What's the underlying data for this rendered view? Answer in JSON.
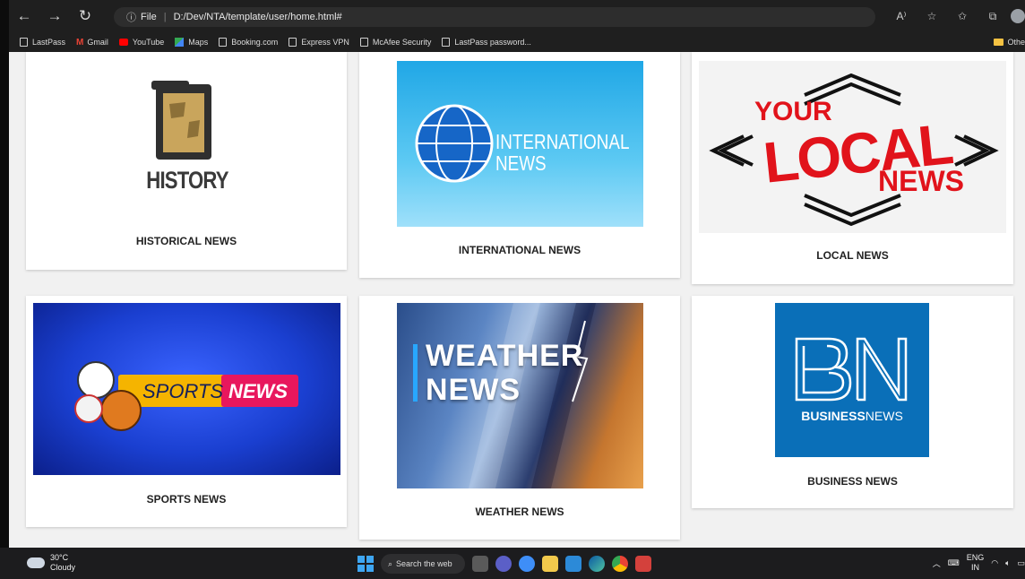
{
  "browser": {
    "address": "D:/Dev/NTA/template/user/home.html#",
    "file_label": "File",
    "bookmarks": [
      "LastPass",
      "Gmail",
      "YouTube",
      "Maps",
      "Booking.com",
      "Express VPN",
      "McAfee Security",
      "LastPass password..."
    ],
    "other_bookmarks": "Othe"
  },
  "cards": [
    {
      "caption": "HISTORICAL NEWS",
      "logo": "HISTORY NEWS"
    },
    {
      "caption": "INTERNATIONAL NEWS",
      "logo_line1": "INTERNATIONAL",
      "logo_line2": "NEWS"
    },
    {
      "caption": "LOCAL NEWS",
      "logo_line1": "YOUR",
      "logo_line2": "LOCAL",
      "logo_line3": "NEWS"
    },
    {
      "caption": "SPORTS NEWS",
      "logo_line1": "SPORTS",
      "logo_line2": "NEWS"
    },
    {
      "caption": "WEATHER NEWS",
      "logo_line1": "WEATHER",
      "logo_line2": "NEWS"
    },
    {
      "caption": "BUSINESS NEWS",
      "logo_mark": "BN",
      "logo_bold": "BUSINESS",
      "logo_light": "NEWS"
    }
  ],
  "taskbar": {
    "temperature": "30°C",
    "condition": "Cloudy",
    "search_placeholder": "Search the web",
    "lang_line1": "ENG",
    "lang_line2": "IN"
  },
  "colors": {
    "accent_blue": "#0a6fb8",
    "local_red": "#e1131b",
    "sports_blue": "#1a3fd0"
  }
}
